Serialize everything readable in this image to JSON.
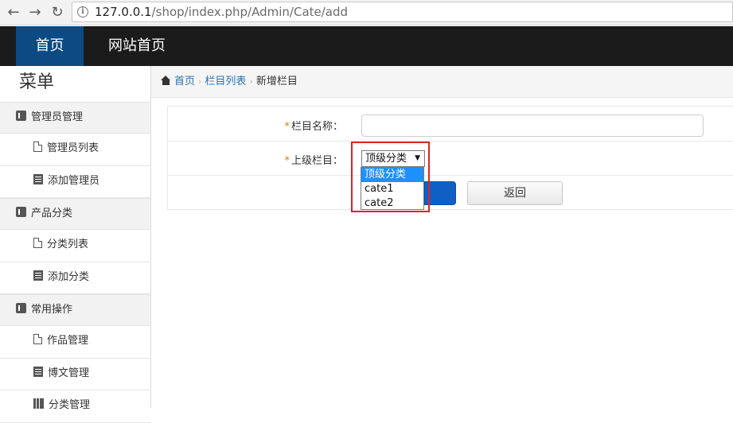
{
  "browser": {
    "url_host": "127.0.0.1",
    "url_path": "/shop/index.php/Admin/Cate/add"
  },
  "topnav": {
    "home": "首页",
    "site_home": "网站首页"
  },
  "sidebar": {
    "title": "菜单",
    "groups": [
      {
        "label": "管理员管理",
        "items": [
          "管理员列表",
          "添加管理员"
        ]
      },
      {
        "label": "产品分类",
        "items": [
          "分类列表",
          "添加分类"
        ]
      },
      {
        "label": "常用操作",
        "items": [
          "作品管理",
          "博文管理",
          "分类管理"
        ]
      }
    ]
  },
  "breadcrumb": {
    "home": "首页",
    "list": "栏目列表",
    "current": "新增栏目"
  },
  "form": {
    "required_mark": "*",
    "name_label": "栏目名称：",
    "name_value": "",
    "parent_label": "上级栏目：",
    "parent_selected": "顶级分类",
    "parent_options": [
      "顶级分类",
      "cate1",
      "cate2"
    ],
    "back_label": "返回"
  },
  "colors": {
    "topnav_bg": "#1b1b1b",
    "topnav_active": "#0d4a84",
    "link": "#2a72b5",
    "required": "#e07c00",
    "annotation": "#d9232a"
  }
}
